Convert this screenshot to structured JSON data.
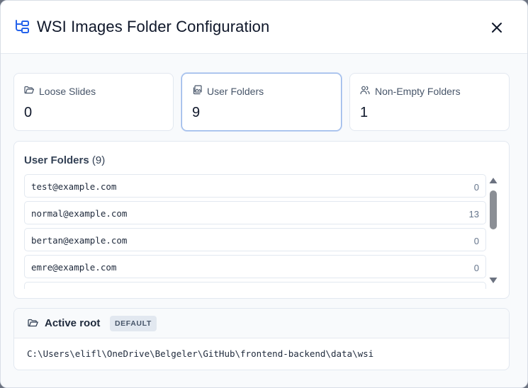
{
  "dialog": {
    "title": "WSI Images Folder Configuration",
    "title_icon": "folder-tree-icon",
    "close_icon": "close-icon"
  },
  "stats": [
    {
      "label": "Loose Slides",
      "value": "0",
      "icon": "folder-open-icon",
      "active": false
    },
    {
      "label": "User Folders",
      "value": "9",
      "icon": "stacked-images-icon",
      "active": true
    },
    {
      "label": "Non-Empty Folders",
      "value": "1",
      "icon": "users-icon",
      "active": false
    }
  ],
  "user_folders": {
    "title": "User Folders",
    "count": "(9)",
    "rows": [
      {
        "email": "test@example.com",
        "count": "0"
      },
      {
        "email": "normal@example.com",
        "count": "13"
      },
      {
        "email": "bertan@example.com",
        "count": "0"
      },
      {
        "email": "emre@example.com",
        "count": "0"
      },
      {
        "email": "",
        "count": ""
      }
    ]
  },
  "active_root": {
    "title": "Active root",
    "badge": "DEFAULT",
    "path": "C:\\Users\\elifl\\OneDrive\\Belgeler\\GitHub\\frontend-backend\\data\\wsi"
  },
  "colors": {
    "accent": "#2563eb",
    "active_border": "#93b4e8",
    "scrollbar": "#8b8f95"
  }
}
